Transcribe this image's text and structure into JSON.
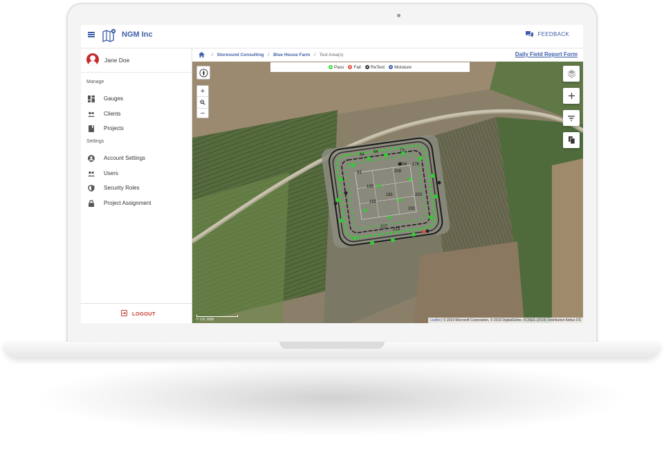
{
  "header": {
    "company": "NGM Inc",
    "feedback_label": "FEEDBACK"
  },
  "user": {
    "name": "Jane Doe"
  },
  "sidebar": {
    "manage_label": "Manage",
    "manage_items": [
      {
        "label": "Gauges",
        "icon": "dashboard-icon"
      },
      {
        "label": "Clients",
        "icon": "people-icon"
      },
      {
        "label": "Projects",
        "icon": "book-icon"
      }
    ],
    "settings_label": "Settings",
    "settings_items": [
      {
        "label": "Account Settings",
        "icon": "account-icon"
      },
      {
        "label": "Users",
        "icon": "people-icon"
      },
      {
        "label": "Security Roles",
        "icon": "shield-icon"
      },
      {
        "label": "Project Assignment",
        "icon": "lock-icon"
      }
    ],
    "logout_label": "LOGOUT"
  },
  "breadcrumb": {
    "items": [
      "Storesund Consulting",
      "Blue House Farm"
    ],
    "current": "Test Area(s)"
  },
  "report_link": "Daily Field Report Form",
  "legend": [
    {
      "label": "Pass",
      "color": "#3ddc3d"
    },
    {
      "label": "Fail",
      "color": "#e74c3c"
    },
    {
      "label": "ReTest",
      "color": "#333333"
    },
    {
      "label": "Moisture",
      "color": "#3e5ea8"
    }
  ],
  "map_labels": [
    "84",
    "64",
    "73",
    "93",
    "176",
    "209",
    "204",
    "189",
    "183",
    "181",
    "217",
    "213",
    "191",
    "203"
  ],
  "attribution": {
    "leaflet": "Leaflet",
    "text": "| © 2019 Microsoft Corporation, © 2019 DigitalGlobe, ©CNES (2019) Distribution Airbus DS"
  },
  "scale": {
    "label": "5       100      200ft"
  },
  "colors": {
    "accent": "#3e5ea8",
    "logout": "#c0392b",
    "pass": "#3ddc3d"
  }
}
